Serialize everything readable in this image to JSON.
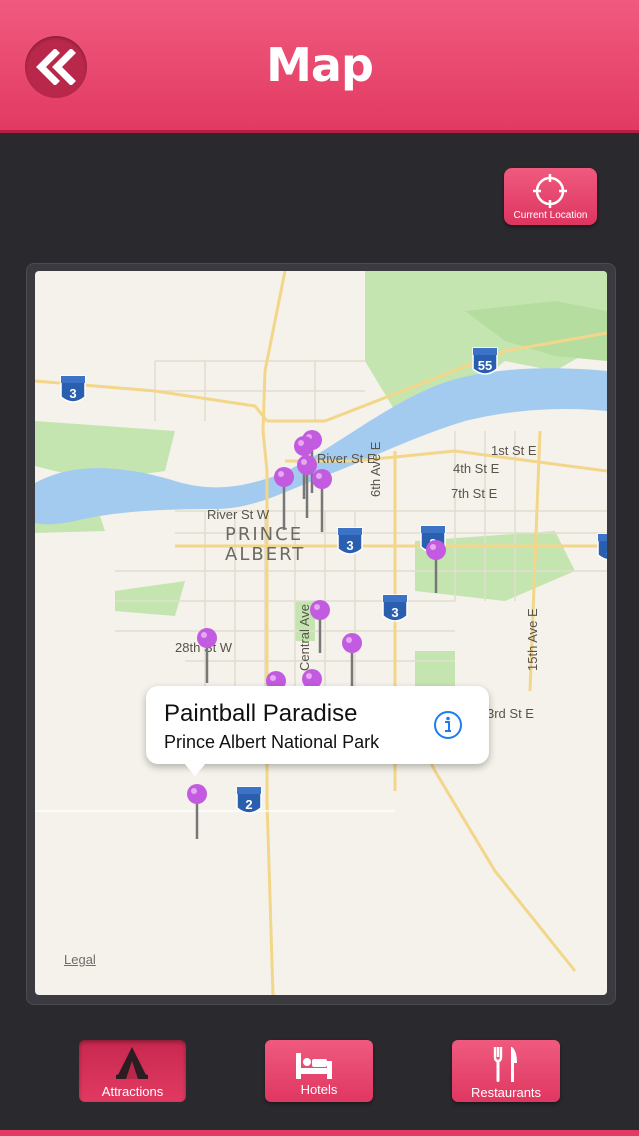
{
  "header": {
    "title": "Map",
    "back_icon": "double-chevron-left-icon"
  },
  "current_location": {
    "label": "Current Location",
    "icon": "crosshair-icon"
  },
  "map": {
    "street_labels": [
      "River St W",
      "River St E",
      "1st St E",
      "4th St E",
      "7th St E",
      "28th St W",
      "6th Ave E",
      "Central Ave",
      "15th Ave E",
      "3rd St E"
    ],
    "city_label_line1": "PRINCE",
    "city_label_line2": "ALBERT",
    "highway_shields": [
      "3",
      "55",
      "3",
      "3",
      "3",
      "2",
      "3"
    ],
    "legal_label": "Legal",
    "water_color": "#a3cbf0",
    "park_color": "#c4e5b0",
    "pin_color": "#c35be0"
  },
  "callout": {
    "title": "Paintball Paradise",
    "subtitle": "Prince Albert National Park",
    "info_icon": "info-circle-icon"
  },
  "tabs": [
    {
      "label": "Attractions",
      "icon": "tent-icon",
      "active": true
    },
    {
      "label": "Hotels",
      "icon": "bed-icon",
      "active": false
    },
    {
      "label": "Restaurants",
      "icon": "fork-knife-icon",
      "active": false
    }
  ],
  "colors": {
    "accent": "#e23a62",
    "background": "#2a292e"
  }
}
